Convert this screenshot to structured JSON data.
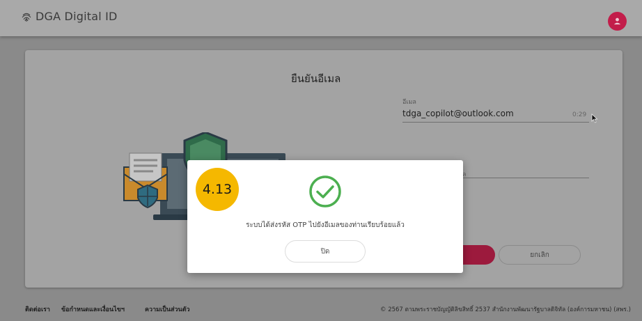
{
  "header": {
    "app_name": "DGA Digital ID",
    "logo_icon": "fingerprint-icon",
    "avatar_icon": "user-icon",
    "accent_color": "#d81b60"
  },
  "card": {
    "title": "ยืนยันอีเมล",
    "email_label": "อีเมล",
    "email_value": "tdga_copilot@outlook.com",
    "otp_timer": "0:29",
    "otp_hint": "ล",
    "cancel_label": "ยกเลิก"
  },
  "modal": {
    "icon": "check-circle-icon",
    "message": "ระบบได้ส่งรหัส OTP ไปยังอีเมลของท่านเรียบร้อยแล้ว",
    "close_label": "ปิด",
    "success_color": "#4caf50"
  },
  "annotation": {
    "step_label": "4.13",
    "badge_color": "#f5b800"
  },
  "footer": {
    "contact": "ติดต่อเรา",
    "terms": "ข้อกำหนดและเงื่อนไขฯ",
    "privacy": "ความเป็นส่วนตัว",
    "copyright": "© 2567 ตามพระราชบัญญัติลิขสิทธิ์ 2537 สำนักงานพัฒนารัฐบาลดิจิทัล (องค์การมหาชน) (สพร.)"
  }
}
